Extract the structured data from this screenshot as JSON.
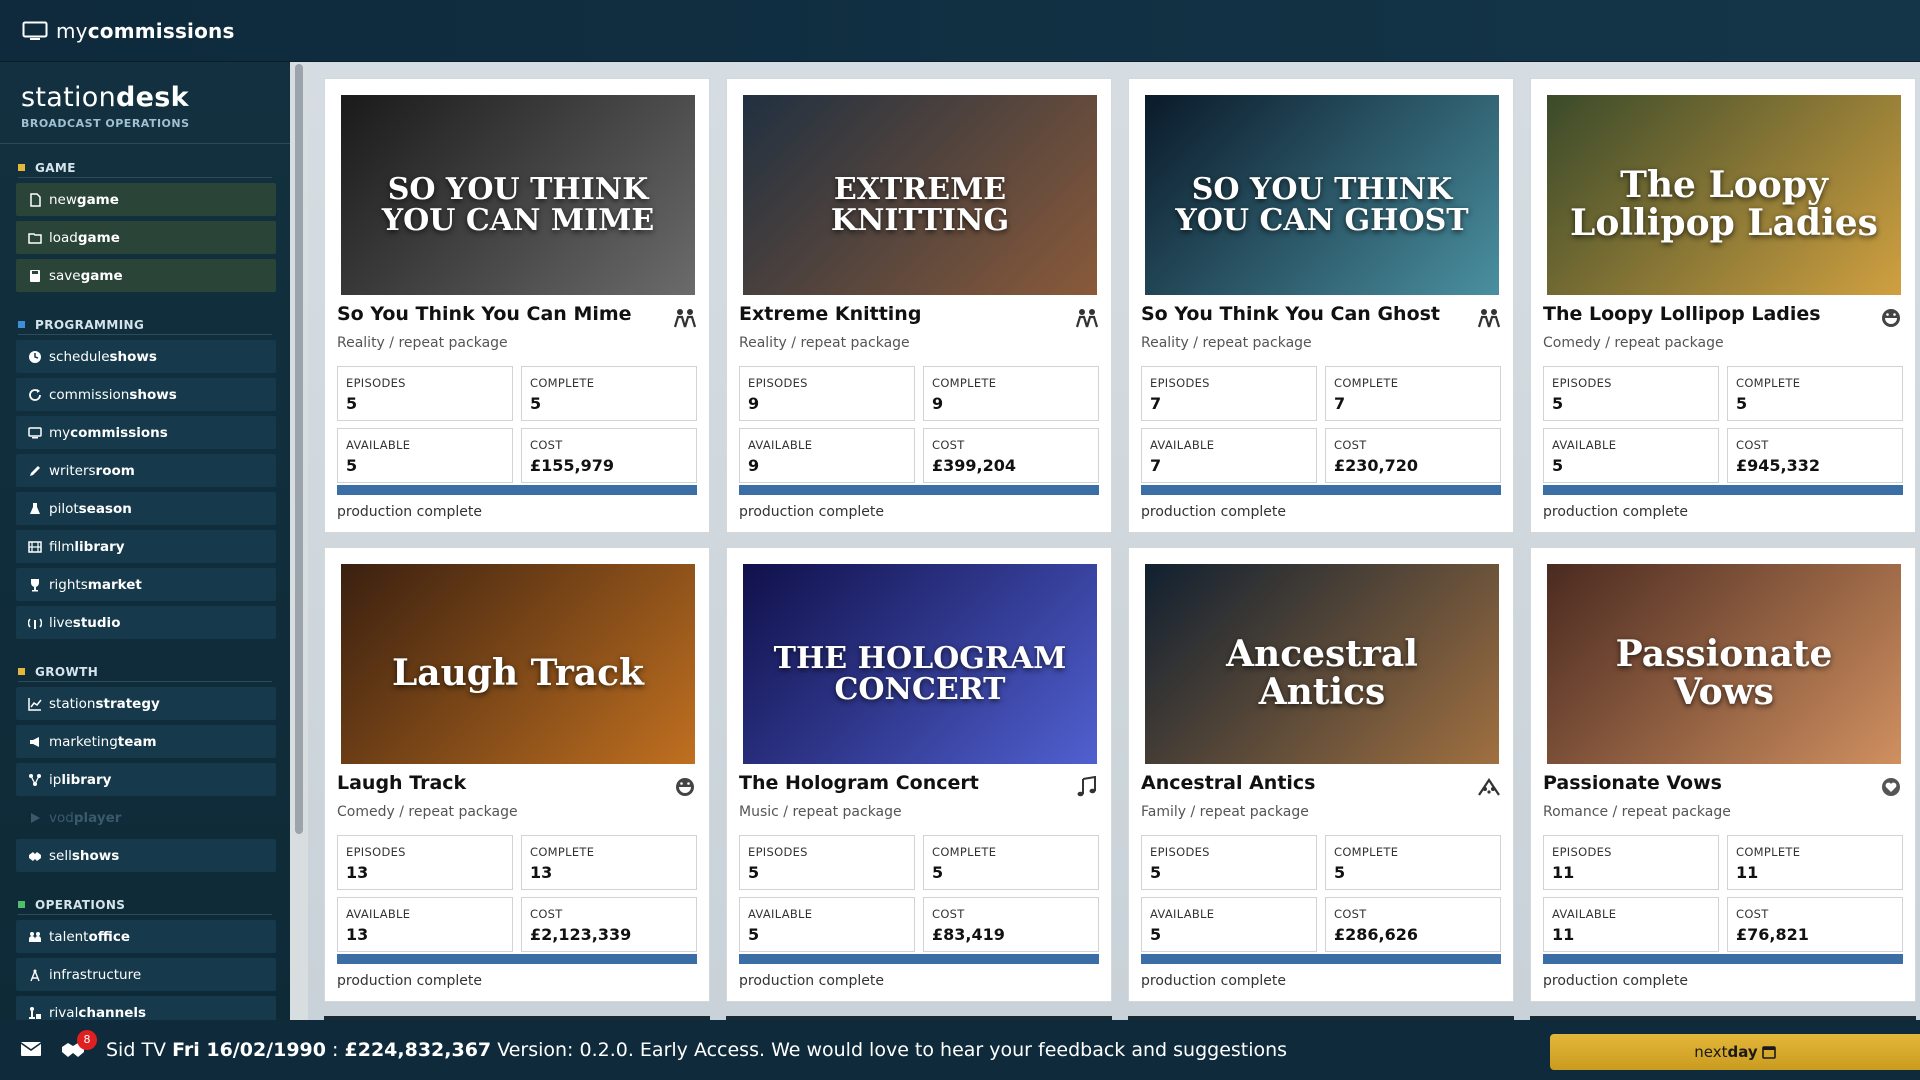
{
  "app": {
    "title_light": "my",
    "title_bold": "commissions"
  },
  "brand": {
    "title_light": "station",
    "title_bold": "desk",
    "subtitle": "BROADCAST OPERATIONS"
  },
  "sidebar": {
    "sections": [
      {
        "title": "GAME",
        "color": "#e4b73a",
        "items": [
          {
            "light": "new",
            "bold": "game",
            "icon": "file-icon"
          },
          {
            "light": "load",
            "bold": "game",
            "icon": "folder-open-icon"
          },
          {
            "light": "save",
            "bold": "game",
            "icon": "floppy-icon"
          }
        ]
      },
      {
        "title": "PROGRAMMING",
        "color": "#3d8fd8",
        "items": [
          {
            "light": "schedule",
            "bold": "shows",
            "icon": "clock-icon"
          },
          {
            "light": "commission",
            "bold": "shows",
            "icon": "refresh-icon"
          },
          {
            "light": "my",
            "bold": "commissions",
            "icon": "monitor-icon"
          },
          {
            "light": "writers",
            "bold": "room",
            "icon": "pen-icon"
          },
          {
            "light": "pilot",
            "bold": "season",
            "icon": "flask-icon"
          },
          {
            "light": "film",
            "bold": "library",
            "icon": "film-icon"
          },
          {
            "light": "rights",
            "bold": "market",
            "icon": "trophy-icon"
          },
          {
            "light": "live",
            "bold": "studio",
            "icon": "broadcast-icon"
          }
        ]
      },
      {
        "title": "GROWTH",
        "color": "#e4b73a",
        "items": [
          {
            "light": "station",
            "bold": "strategy",
            "icon": "chart-line-icon"
          },
          {
            "light": "marketing",
            "bold": "team",
            "icon": "megaphone-icon"
          },
          {
            "light": "ip",
            "bold": "library",
            "icon": "network-icon"
          },
          {
            "light": "vod",
            "bold": "player",
            "icon": "play-icon",
            "disabled": true
          },
          {
            "light": "sell",
            "bold": "shows",
            "icon": "handshake-icon"
          }
        ]
      },
      {
        "title": "OPERATIONS",
        "color": "#4fbf6a",
        "items": [
          {
            "light": "talent",
            "bold": "office",
            "icon": "users-icon"
          },
          {
            "light": "",
            "bold": "infrastructure",
            "icon": "tower-icon",
            "plain": true
          },
          {
            "light": "rival",
            "bold": "channels",
            "icon": "chess-icon"
          }
        ]
      }
    ]
  },
  "labels": {
    "episodes": "EPISODES",
    "complete": "COMPLETE",
    "available": "AVAILABLE",
    "cost": "COST"
  },
  "shows": [
    {
      "title": "So You Think You Can Mime",
      "subtitle": "Reality / repeat package",
      "episodes": "5",
      "complete": "5",
      "available": "5",
      "cost": "£155,979",
      "status": "production complete",
      "progress": 1.0,
      "icon": "people-icon",
      "poster_text": "SO YOU THINK YOU CAN MIME",
      "poster_colors": [
        "#1a1a1a",
        "#6b6b6b"
      ]
    },
    {
      "title": "Extreme Knitting",
      "subtitle": "Reality / repeat package",
      "episodes": "9",
      "complete": "9",
      "available": "9",
      "cost": "£399,204",
      "status": "production complete",
      "progress": 1.0,
      "icon": "people-icon",
      "poster_text": "EXTREME KNITTING",
      "poster_colors": [
        "#203040",
        "#8a5a3a"
      ]
    },
    {
      "title": "So You Think You Can Ghost",
      "subtitle": "Reality / repeat package",
      "episodes": "7",
      "complete": "7",
      "available": "7",
      "cost": "£230,720",
      "status": "production complete",
      "progress": 1.0,
      "icon": "people-icon",
      "poster_text": "SO YOU THINK YOU CAN GHOST",
      "poster_colors": [
        "#0a1a2a",
        "#4a90a0"
      ]
    },
    {
      "title": "The Loopy Lollipop Ladies",
      "subtitle": "Comedy / repeat package",
      "episodes": "5",
      "complete": "5",
      "available": "5",
      "cost": "£945,332",
      "status": "production complete",
      "progress": 1.0,
      "icon": "laugh-icon",
      "poster_text": "The Loopy Lollipop Ladies",
      "poster_colors": [
        "#3a4a2a",
        "#d0a040"
      ]
    },
    {
      "title": "Laugh Track",
      "subtitle": "Comedy / repeat package",
      "episodes": "13",
      "complete": "13",
      "available": "13",
      "cost": "£2,123,339",
      "status": "production complete",
      "progress": 1.0,
      "icon": "laugh-icon",
      "poster_text": "Laugh Track",
      "poster_colors": [
        "#3a2010",
        "#c07020"
      ]
    },
    {
      "title": "The Hologram Concert",
      "subtitle": "Music / repeat package",
      "episodes": "5",
      "complete": "5",
      "available": "5",
      "cost": "£83,419",
      "status": "production complete",
      "progress": 1.0,
      "icon": "music-icon",
      "poster_text": "THE HOLOGRAM CONCERT",
      "poster_colors": [
        "#10104a",
        "#5060d0"
      ]
    },
    {
      "title": "Ancestral Antics",
      "subtitle": "Family / repeat package",
      "episodes": "5",
      "complete": "5",
      "available": "5",
      "cost": "£286,626",
      "status": "production complete",
      "progress": 1.0,
      "icon": "family-icon",
      "poster_text": "Ancestral Antics",
      "poster_colors": [
        "#102030",
        "#a07040"
      ]
    },
    {
      "title": "Passionate Vows",
      "subtitle": "Romance / repeat package",
      "episodes": "11",
      "complete": "11",
      "available": "11",
      "cost": "£76,821",
      "status": "production complete",
      "progress": 1.0,
      "icon": "heart-icon",
      "poster_text": "Passionate Vows",
      "poster_colors": [
        "#4a2a20",
        "#d09060"
      ]
    }
  ],
  "footer": {
    "notification_count": "8",
    "station": "Sid TV",
    "date": "Fri 16/02/1990",
    "sep": ":",
    "balance": "£224,832,367",
    "message": "Version: 0.2.0. Early Access. We would love to hear your feedback and suggestions",
    "next_light": "next",
    "next_bold": "day"
  },
  "colors": {
    "progress_fill": "#3a6ea5",
    "accent_gold": "#e4b73a",
    "badge_red": "#e02020"
  }
}
